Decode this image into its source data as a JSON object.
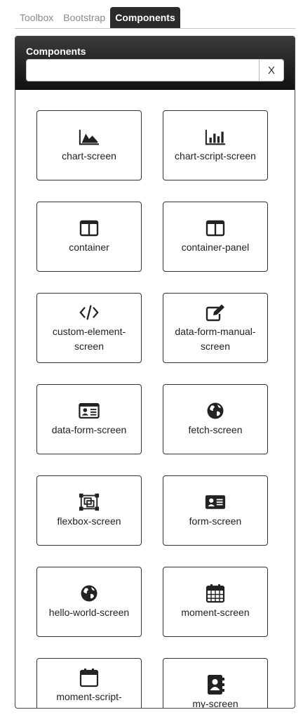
{
  "tabs": [
    {
      "label": "Toolbox",
      "active": false
    },
    {
      "label": "Bootstrap",
      "active": false
    },
    {
      "label": "Components",
      "active": true
    }
  ],
  "panel": {
    "title": "Components",
    "search": {
      "value": "",
      "placeholder": "",
      "clear_label": "X"
    }
  },
  "components": [
    {
      "label": "chart-screen",
      "icon": "area-chart-icon"
    },
    {
      "label": "chart-script-screen",
      "icon": "bar-chart-icon"
    },
    {
      "label": "container",
      "icon": "columns-icon"
    },
    {
      "label": "container-panel",
      "icon": "columns-icon"
    },
    {
      "label": "custom-element-",
      "label2": "screen",
      "icon": "code-icon"
    },
    {
      "label": "data-form-manual-",
      "label2": "screen",
      "icon": "edit-icon"
    },
    {
      "label": "data-form-screen",
      "icon": "id-card-icon"
    },
    {
      "label": "fetch-screen",
      "icon": "globe-icon"
    },
    {
      "label": "flexbox-screen",
      "icon": "object-group-icon"
    },
    {
      "label": "form-screen",
      "icon": "id-card-solid-icon"
    },
    {
      "label": "hello-world-screen",
      "icon": "globe-icon"
    },
    {
      "label": "moment-screen",
      "icon": "calendar-grid-icon"
    },
    {
      "label": "moment-script-screen",
      "icon": "calendar-icon"
    },
    {
      "label": "my-screen",
      "icon": "address-book-icon"
    }
  ]
}
